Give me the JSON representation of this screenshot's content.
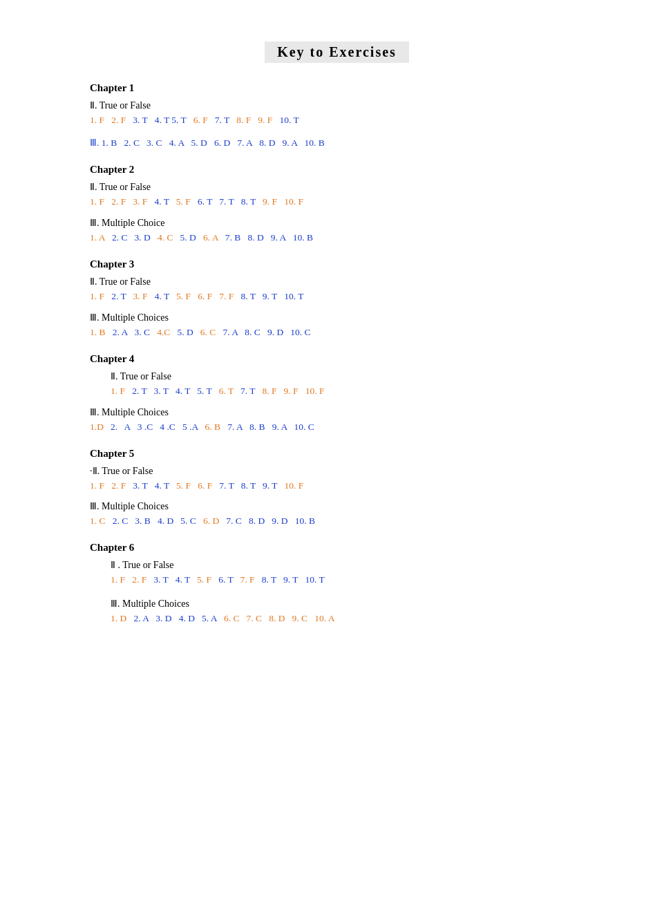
{
  "title": "Key  to  Exercises",
  "chapters": [
    {
      "id": "ch1",
      "label": "Chapter  1",
      "sections": [
        {
          "id": "ch1-s2",
          "label": "Ⅱ. True or False",
          "indent": false,
          "answers": [
            {
              "num": "1.",
              "val": "F",
              "color": "orange"
            },
            {
              "num": "2. F",
              "val": "",
              "color": "orange"
            },
            {
              "num": "3. T",
              "val": "",
              "color": "blue"
            },
            {
              "num": "4. T",
              "val": "",
              "color": "blue"
            },
            {
              "num": "5. T",
              "val": "",
              "color": "blue"
            },
            {
              "num": "6. F",
              "val": "",
              "color": "orange"
            },
            {
              "num": "7. T",
              "val": "",
              "color": "blue"
            },
            {
              "num": "8. F",
              "val": "",
              "color": "orange"
            },
            {
              "num": "9. F",
              "val": "",
              "color": "orange"
            },
            {
              "num": "10. T",
              "val": "",
              "color": "blue"
            }
          ],
          "raw": "1. F   2. F   3. T   4. T 5. T   6. F   7. T   8. F   9. F   10. T"
        },
        {
          "id": "ch1-s3",
          "label": "Ⅲ. 1. B   2. C   3. C   4. A   5. D   6. D   7. A   8. D   9. A   10. B",
          "indent": false,
          "raw": "Ⅲ. 1. B   2. C   3. C   4. A   5. D   6. D   7. A   8. D   9. A   10. B"
        }
      ]
    },
    {
      "id": "ch2",
      "label": "Chapter  2",
      "sections": [
        {
          "id": "ch2-s2",
          "label": "Ⅱ. True or False",
          "raw_answers": "1. F   2. F   3. F   4. T   5. F   6. T   7. T   8. T   9. F   10. F"
        },
        {
          "id": "ch2-s3",
          "label": "Ⅲ. Multiple Choice",
          "raw_answers": "1. A   2. C   3. D   4. C   5. D   6. A   7. B   8. D   9. A   10. B"
        }
      ]
    },
    {
      "id": "ch3",
      "label": "Chapter  3",
      "sections": [
        {
          "id": "ch3-s2",
          "label": "Ⅱ. True or False",
          "raw_answers": "1. F   2. T   3. F   4. T   5. F   6. F   7. F   8. T   9. T   10. T"
        },
        {
          "id": "ch3-s3",
          "label": "Ⅲ. Multiple Choices",
          "raw_answers": "1. B   2. A   3. C   4.C   5. D   6. C   7. A   8. C   9. D   10. C"
        }
      ]
    },
    {
      "id": "ch4",
      "label": "Chapter  4",
      "sections": [
        {
          "id": "ch4-s2",
          "label": "Ⅱ. True or False",
          "indent": true,
          "raw_answers": "1. F   2. T   3. T   4. T   5. T   6. T   7. T   8. F   9. F   10. F"
        },
        {
          "id": "ch4-s3",
          "label": "Ⅲ. Multiple Choices",
          "raw_answers": "1.D   2.  A   3 .C   4 .C   5 .A   6. B   7. A   8. B   9. A   10. C"
        }
      ]
    },
    {
      "id": "ch5",
      "label": "Chapter  5",
      "sections": [
        {
          "id": "ch5-s2",
          "label": "·Ⅱ. True or False",
          "raw_answers": "1. F   2. F   3. T   4. T   5. F   6. F   7. T   8. T   9. T   10. F"
        },
        {
          "id": "ch5-s3",
          "label": "Ⅲ. Multiple Choices",
          "raw_answers": "1. C   2. C   3. B   4. D   5. C   6. D   7. C   8. D   9. D   10. B"
        }
      ]
    },
    {
      "id": "ch6",
      "label": "Chapter  6",
      "sections": [
        {
          "id": "ch6-s2",
          "label": "Ⅱ . True or False",
          "indent": true,
          "raw_answers": "1. F   2. F   3. T   4. T   5. F   6. T   7. F   8. T   9. T   10. T"
        },
        {
          "id": "ch6-s3",
          "label": "Ⅲ.  Multiple Choices",
          "indent": true,
          "raw_answers": "1. D   2. A   3. D   4. D   5. A   6. C   7. C   8. D   9. C   10. A"
        }
      ]
    }
  ]
}
